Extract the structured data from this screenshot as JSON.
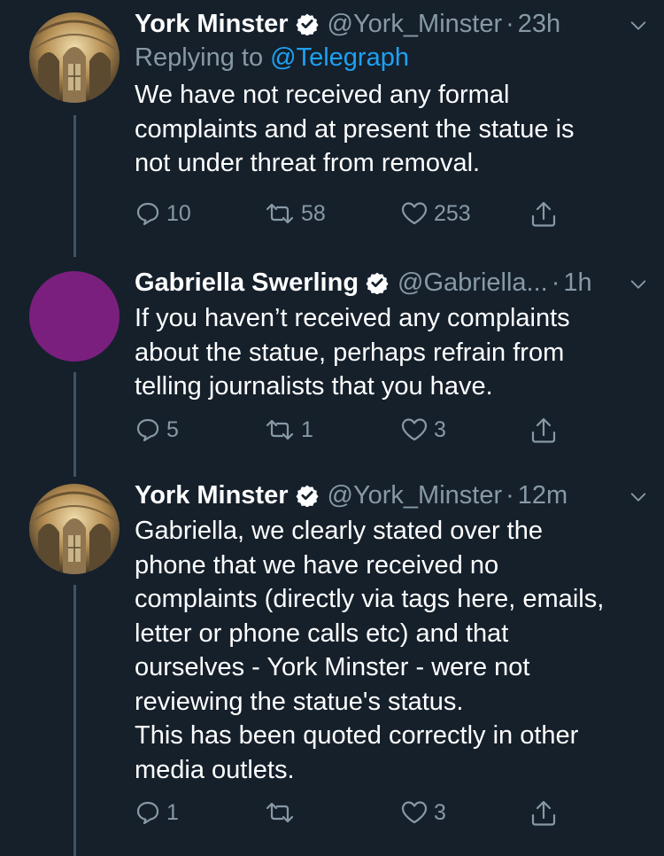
{
  "tweets": [
    {
      "name": "York Minster",
      "handle": "@York_Minster",
      "sep": "·",
      "time": "23h",
      "reply_prefix": "Replying to",
      "reply_mention": "@Telegraph",
      "text": "We have not received any formal\ncomplaints and at present the statue is\nnot under threat from removal.",
      "replies": "10",
      "retweets": "58",
      "likes": "253"
    },
    {
      "name": "Gabriella Swerling",
      "handle": "@Gabriella...",
      "sep": "·",
      "time": "1h",
      "text": "If you haven’t received any complaints\nabout the statue, perhaps refrain from\ntelling journalists that you have.",
      "replies": "5",
      "retweets": "1",
      "likes": "3"
    },
    {
      "name": "York Minster",
      "handle": "@York_Minster",
      "sep": "·",
      "time": "12m",
      "text": "Gabriella, we clearly stated over the\nphone that we have received no\ncomplaints (directly via tags here, emails,\nletter or phone calls etc) and that\nourselves - York Minster - were not\nreviewing the statue's status.\nThis has been quoted correctly in other\nmedia outlets.",
      "replies": "1",
      "retweets": "",
      "likes": "3"
    }
  ],
  "colors": {
    "background": "#15202b",
    "secondary_text": "#8899a6",
    "link": "#1da1f2",
    "thread_line": "#3d5466",
    "avatar_purple": "#7b1f7f"
  },
  "icons": {
    "reply": "reply-icon",
    "retweet": "retweet-icon",
    "like": "heart-icon",
    "share": "share-icon",
    "verified": "verified-badge-icon",
    "more": "chevron-down-icon"
  }
}
